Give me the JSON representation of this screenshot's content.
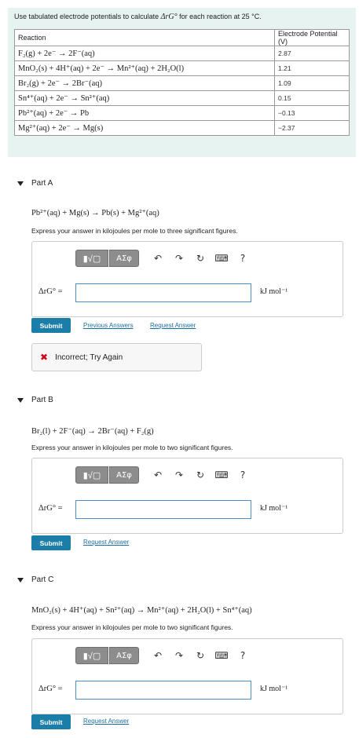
{
  "intro": {
    "text_before": "Use tabulated electrode potentials to calculate ",
    "symbol": "ΔrG°",
    "text_after": " for each reaction at 25 °C.",
    "table": {
      "headers": [
        "Reaction",
        "Electrode Potential (V)"
      ],
      "rows": [
        {
          "reaction": "F₂(g) + 2e⁻ → 2F⁻(aq)",
          "value": "2.87"
        },
        {
          "reaction": "MnO₂(s) + 4H⁺(aq) + 2e⁻ → Mn²⁺(aq) + 2H₂O(l)",
          "value": "1.21"
        },
        {
          "reaction": "Br₂(g) + 2e⁻ → 2Br⁻(aq)",
          "value": "1.09"
        },
        {
          "reaction": "Sn⁴⁺(aq) + 2e⁻ → Sn²⁺(aq)",
          "value": "0.15"
        },
        {
          "reaction": "Pb²⁺(aq) + 2e⁻ → Pb",
          "value": "−0.13"
        },
        {
          "reaction": "Mg²⁺(aq) + 2e⁻ → Mg(s)",
          "value": "−2.37"
        }
      ]
    }
  },
  "toolbar": {
    "templates_label": "▮√▢",
    "greek_label": "ΑΣφ",
    "undo_icon": "↶",
    "redo_icon": "↷",
    "reset_icon": "↻",
    "keyboard_icon": "⌨",
    "help_label": "?"
  },
  "parts": [
    {
      "title": "Part A",
      "reaction": "Pb²⁺(aq) + Mg(s) → Pb(s) + Mg²⁺(aq)",
      "instruction": "Express your answer in kilojoules per mole to three significant figures.",
      "answer_label": "ΔrG° =",
      "answer_value": "",
      "unit": "kJ mol⁻¹",
      "submit_label": "Submit",
      "previous_answers_label": "Previous Answers",
      "request_answer_label": "Request Answer",
      "feedback": "Incorrect; Try Again"
    },
    {
      "title": "Part B",
      "reaction": "Br₂(l) + 2F⁻(aq) → 2Br⁻(aq) + F₂(g)",
      "instruction": "Express your answer in kilojoules per mole to two significant figures.",
      "answer_label": "ΔrG° =",
      "answer_value": "",
      "unit": "kJ mol⁻¹",
      "submit_label": "Submit",
      "request_answer_label": "Request Answer"
    },
    {
      "title": "Part C",
      "reaction": "MnO₂(s) + 4H⁺(aq) + Sn²⁺(aq) → Mn²⁺(aq) + 2H₂O(l) + Sn⁴⁺(aq)",
      "instruction": "Express your answer in kilojoules per mole to two significant figures.",
      "answer_label": "ΔrG° =",
      "answer_value": "",
      "unit": "kJ mol⁻¹",
      "submit_label": "Submit",
      "request_answer_label": "Request Answer"
    }
  ],
  "colors": {
    "intro_bg": "#e7f3f1",
    "submit_bg": "#1a7ea8",
    "link": "#1a6fa3",
    "error": "#d0021b"
  }
}
